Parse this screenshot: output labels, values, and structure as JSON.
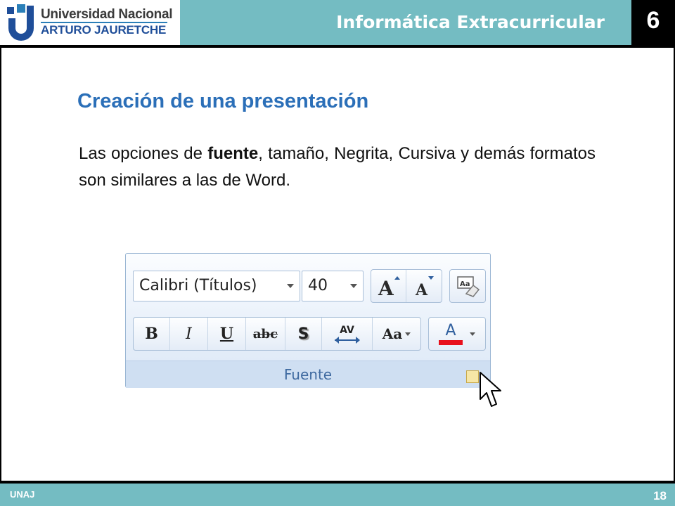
{
  "header": {
    "logo_line1": "Universidad Nacional",
    "logo_line2": "ARTURO JAURETCHE",
    "course_title": "Informática Extracurricular",
    "unit_number": "6"
  },
  "slide": {
    "title": "Creación de una presentación",
    "body_before": "Las opciones de ",
    "body_bold": "fuente",
    "body_after": ", tamaño, Negrita, Cursiva y demás formatos son similares a las de Word."
  },
  "ribbon": {
    "font_name": "Calibri (Títulos)",
    "font_size": "40",
    "group_label": "Fuente",
    "format_buttons": [
      "B",
      "I",
      "U",
      "abc",
      "S",
      "AV",
      "Aa"
    ],
    "font_color_button": "A",
    "font_color_bar": "#e8101c"
  },
  "footer": {
    "left": "UNAJ",
    "page_number": "18"
  },
  "colors": {
    "teal": "#74bcc2",
    "title_blue": "#2b6fb8"
  }
}
